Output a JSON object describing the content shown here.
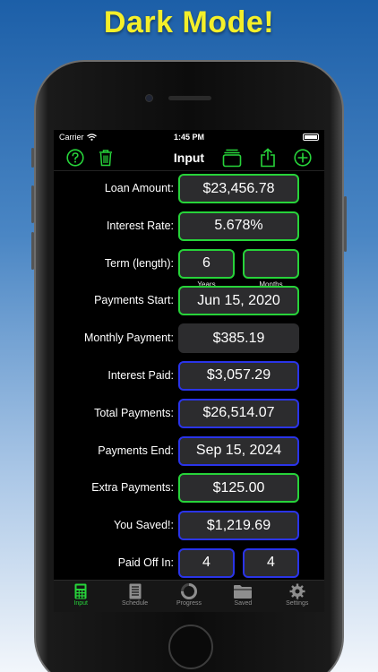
{
  "headline": "Dark Mode!",
  "status": {
    "carrier": "Carrier",
    "time": "1:45 PM"
  },
  "toolbar": {
    "title": "Input"
  },
  "form": {
    "loan_amount": {
      "label": "Loan Amount:",
      "value": "$23,456.78"
    },
    "interest_rate": {
      "label": "Interest Rate:",
      "value": "5.678%"
    },
    "term": {
      "label": "Term (length):",
      "years_value": "6",
      "months_value": "",
      "years_label": "Years",
      "months_label": "Months"
    },
    "payments_start": {
      "label": "Payments Start:",
      "value": "Jun 15, 2020"
    },
    "monthly_payment": {
      "label": "Monthly Payment:",
      "value": "$385.19"
    },
    "interest_paid": {
      "label": "Interest Paid:",
      "value": "$3,057.29"
    },
    "total_payments": {
      "label": "Total Payments:",
      "value": "$26,514.07"
    },
    "payments_end": {
      "label": "Payments End:",
      "value": "Sep 15, 2024"
    },
    "extra_payments": {
      "label": "Extra Payments:",
      "value": "$125.00"
    },
    "you_saved": {
      "label": "You Saved!:",
      "value": "$1,219.69"
    },
    "paid_off_in": {
      "label": "Paid Off In:",
      "years_value": "4",
      "months_value": "4"
    }
  },
  "tabs": [
    {
      "label": "Input",
      "icon": "calculator-icon",
      "active": true
    },
    {
      "label": "Schedule",
      "icon": "document-list-icon",
      "active": false
    },
    {
      "label": "Progress",
      "icon": "progress-ring-icon",
      "active": false
    },
    {
      "label": "Saved",
      "icon": "folder-icon",
      "active": false
    },
    {
      "label": "Settings",
      "icon": "gear-icon",
      "active": false
    }
  ],
  "colors": {
    "accent_green": "#27d33a",
    "accent_blue": "#2a34e8",
    "headline_yellow": "#f4ef2a",
    "field_bg": "#2c2c2e"
  }
}
